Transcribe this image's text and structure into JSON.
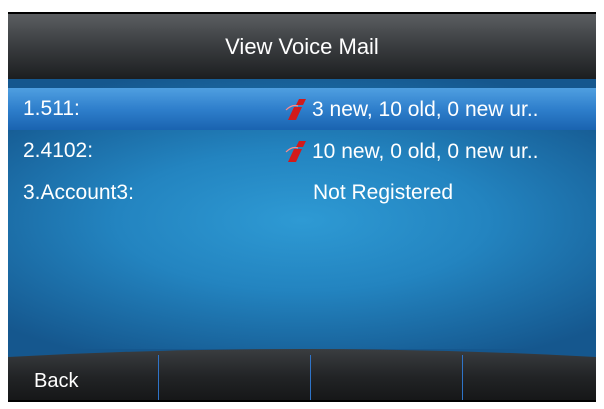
{
  "title": "View Voice Mail",
  "accounts": [
    {
      "label": "1.511:",
      "status": "3 new, 10 old, 0 new ur..",
      "has_messages": true
    },
    {
      "label": "2.4102:",
      "status": "10 new, 0 old, 0 new ur..",
      "has_messages": true
    },
    {
      "label": "3.Account3:",
      "status": "Not Registered",
      "has_messages": false
    }
  ],
  "softkeys": [
    "Back",
    "",
    "",
    ""
  ],
  "colors": {
    "background_blue": "#2384c0",
    "selected_row": "#2f7fcc",
    "info_icon_red": "#d21a1a"
  },
  "icons": {
    "message_indicator": "info-icon"
  }
}
